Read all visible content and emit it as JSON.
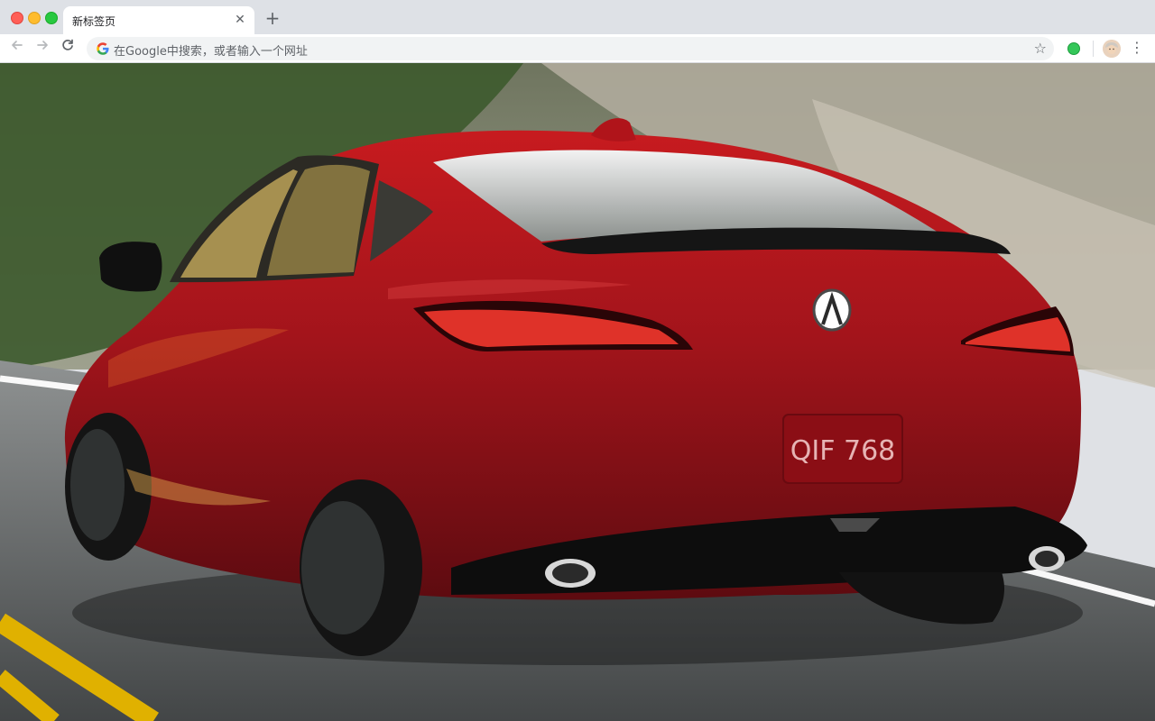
{
  "browser": {
    "tab": {
      "title": "新标签页"
    },
    "omnibox": {
      "placeholder": "在Google中搜索，或者输入一个网址"
    },
    "icons": {
      "back": "arrow-left-icon",
      "forward": "arrow-right-icon",
      "reload": "reload-icon",
      "bookmark": "star-icon",
      "extension": "green-dot-icon",
      "profile": "avatar-icon",
      "menu": "kebab-menu-icon"
    },
    "colors": {
      "tabstrip": "#dee1e6",
      "accent": "#1a73e8"
    }
  },
  "background": {
    "description_color": "#b01818",
    "plate_text": "QIF 768"
  }
}
